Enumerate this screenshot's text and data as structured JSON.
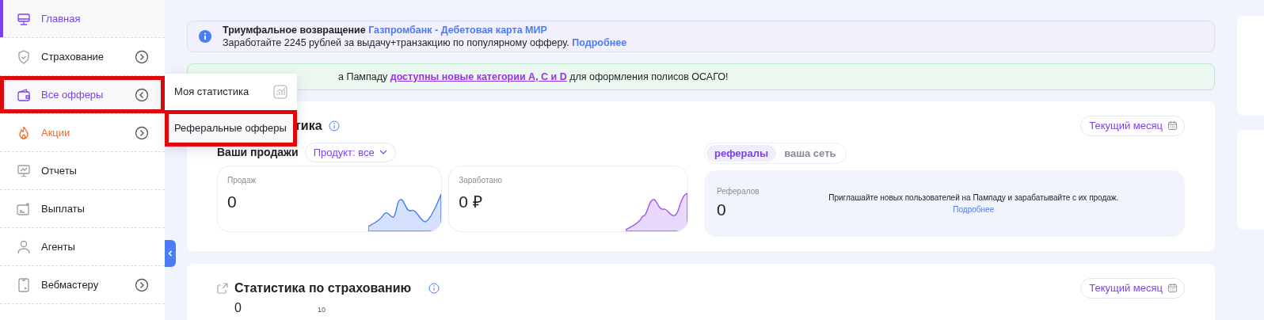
{
  "sidebar": {
    "items": [
      {
        "label": "Главная",
        "selected": true,
        "color": "#7a40f2",
        "submenu": false,
        "highlighted": false
      },
      {
        "label": "Страхование",
        "selected": false,
        "color": "#1f1f24",
        "submenu": true,
        "expanded": false,
        "highlighted": false
      },
      {
        "label": "Все офферы",
        "selected": false,
        "color": "#7a40f2",
        "submenu": true,
        "expanded": true,
        "highlighted": true
      },
      {
        "label": "Акции",
        "selected": false,
        "color": "#f5661f",
        "submenu": true,
        "expanded": false,
        "highlighted": false
      },
      {
        "label": "Отчеты",
        "selected": false,
        "color": "#1f1f24",
        "submenu": false,
        "highlighted": false
      },
      {
        "label": "Выплаты",
        "selected": false,
        "color": "#1f1f24",
        "submenu": false,
        "highlighted": false
      },
      {
        "label": "Агенты",
        "selected": false,
        "color": "#1f1f24",
        "submenu": false,
        "highlighted": false
      },
      {
        "label": "Вебмастеру",
        "selected": false,
        "color": "#1f1f24",
        "submenu": true,
        "expanded": false,
        "highlighted": false
      }
    ]
  },
  "submenu": {
    "items": [
      {
        "label": "Моя статистика",
        "highlighted": false
      },
      {
        "label": "Реферальные офферы",
        "highlighted": true
      }
    ]
  },
  "banners": [
    {
      "kind": "info",
      "title": "**Триумфальное возвращение**",
      "link": "Газпромбанк - Дебетовая карта МИР",
      "text": "Заработайте 2245 рублей за выдачу+транзакцию по популярному офферу.",
      "more": "Подробнее"
    },
    {
      "kind": "success",
      "before": "а Пампаду",
      "link": "доступны новые категории A, C и D",
      "after": "для оформления полисов ОСАГО!"
    }
  ],
  "stats_card": {
    "title": "тика",
    "period": "Текущий месяц",
    "sales_label": "Ваши продажи",
    "product_filter": "Продукт: все",
    "tiles": [
      {
        "label": "Продаж",
        "value": "0"
      },
      {
        "label": "Заработано",
        "value": "0 ₽"
      }
    ],
    "tabs": [
      {
        "label": "рефералы",
        "selected": true
      },
      {
        "label": "ваша сеть",
        "selected": false
      }
    ],
    "referrals": {
      "label": "Рефералов",
      "value": "0",
      "text": "Приглашайте новых пользователей на Пампаду и зарабатывайте с их продаж.",
      "more": "Подробнее"
    }
  },
  "insurance_card": {
    "title": "Статистика по страхованию",
    "period": "Текущий месяц",
    "value": "0",
    "tick": "10"
  }
}
